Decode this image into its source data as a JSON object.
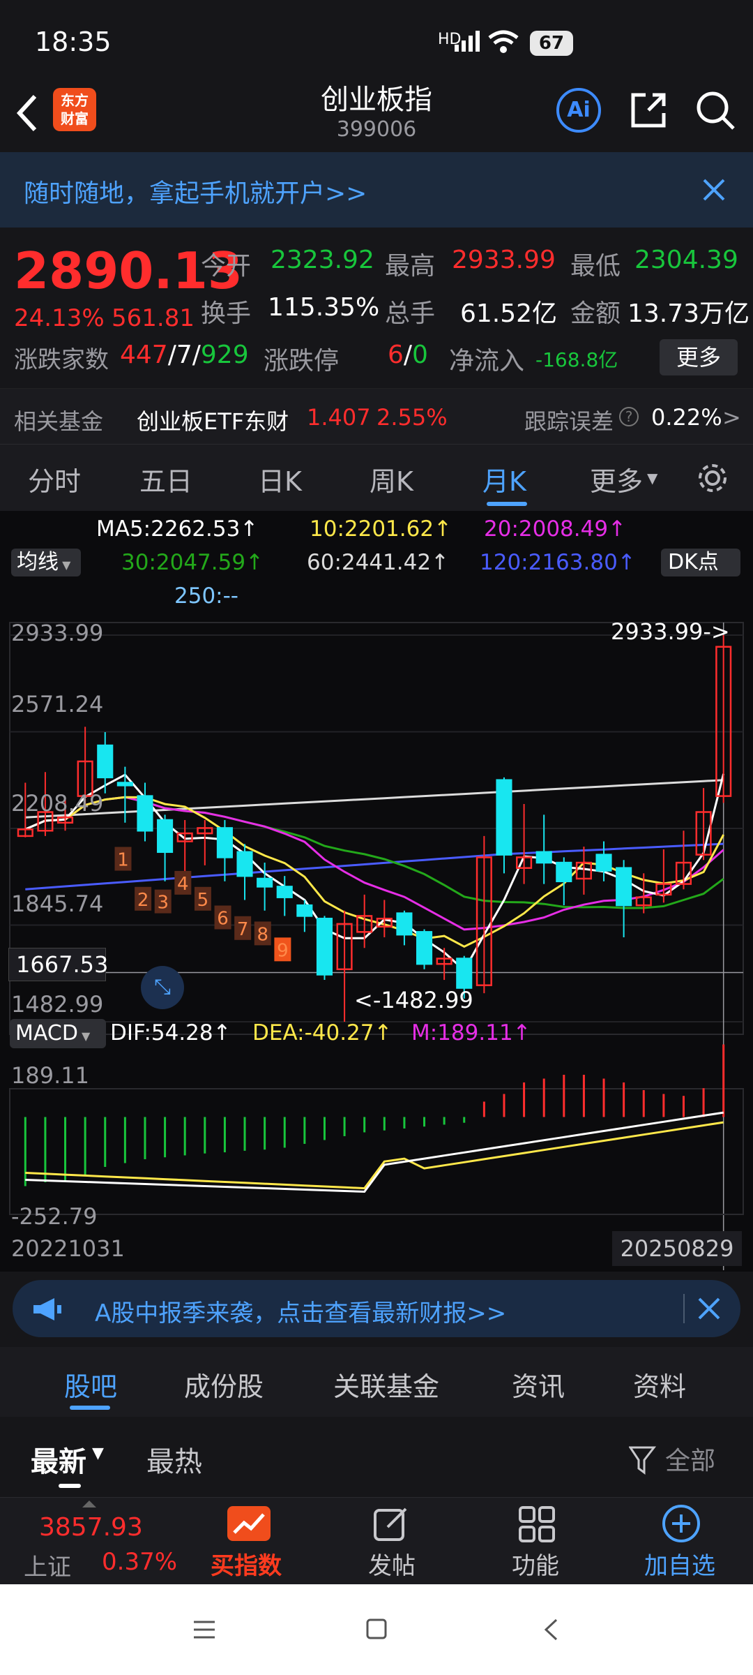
{
  "status": {
    "time": "18:35",
    "battery": "67",
    "signal": "HD"
  },
  "header": {
    "title": "创业板指",
    "code": "399006",
    "logo_line1": "东方",
    "logo_line2": "财富",
    "ai_label": "Ai"
  },
  "banner": {
    "text": "随时随地，拿起手机就开户>>"
  },
  "quote": {
    "price": "2890.13",
    "pct": "24.13%",
    "change": "561.81",
    "open_label": "今开",
    "open": "2323.92",
    "high_label": "最高",
    "high": "2933.99",
    "low_label": "最低",
    "low": "2304.39",
    "turnover_label": "换手",
    "turnover": "115.35%",
    "volume_label": "总手",
    "volume": "61.52亿",
    "amount_label": "金额",
    "amount": "13.73万亿",
    "updown_label": "涨跌家数",
    "up": "447",
    "flat": "7",
    "down": "929",
    "limit_label": "涨跌停",
    "limit_up": "6",
    "limit_down": "0",
    "inflow_label": "净流入",
    "inflow": "-168.8亿",
    "more": "更多"
  },
  "fund": {
    "label": "相关基金",
    "name": "创业板ETF东财",
    "price": "1.407",
    "pct": "2.55%",
    "track_label": "跟踪误差",
    "track_value": "0.22%",
    "arrow": ">"
  },
  "tabs": {
    "items": [
      "分时",
      "五日",
      "日K",
      "周K",
      "月K",
      "更多"
    ],
    "active": "月K"
  },
  "ma": {
    "ma5": "MA5:2262.53↑",
    "ma10": "10:2201.62↑",
    "ma20": "20:2008.49↑",
    "ma30": "30:2047.59↑",
    "ma60": "60:2441.42↑",
    "ma120": "120:2163.80↑",
    "ma250": "250:--",
    "selector": "均线",
    "dk": "DK点"
  },
  "axis": {
    "y1": "2933.99",
    "y2": "2571.24",
    "y3": "2208.49",
    "y4": "1845.74",
    "y5": "1482.99",
    "crosshair": "1667.53",
    "high_note": "2933.99->",
    "low_note": "<-1482.99"
  },
  "macd": {
    "label": "MACD",
    "dif": "DIF:54.28↑",
    "dea": "DEA:-40.27↑",
    "m": "M:189.11↑",
    "ytop": "189.11",
    "ybot": "-252.79",
    "date_start": "20221031",
    "date_end": "20250829"
  },
  "colors": {
    "up": "#ff2d2d",
    "down": "#18c63c",
    "cyan": "#18e6f0",
    "ma5": "#ffffff",
    "ma10": "#ffe84a",
    "ma20": "#e62ee6",
    "ma30": "#23a81a",
    "ma60": "#dcdcdc",
    "ma120": "#4a5cff",
    "accent": "#4ea3ff"
  },
  "nine_labels": [
    "1",
    "2",
    "3",
    "4",
    "5",
    "6",
    "7",
    "8",
    "9"
  ],
  "ad": {
    "text": "A股中报季来袭，点击查看最新财报>>"
  },
  "bottom_tabs": {
    "items": [
      "股吧",
      "成份股",
      "关联基金",
      "资讯",
      "资料"
    ],
    "active": "股吧"
  },
  "sort": {
    "latest": "最新",
    "hot": "最热",
    "filter": "全部"
  },
  "nav": {
    "index_price": "3857.93",
    "index_name": "上证",
    "index_pct": "0.37%",
    "buy": "买指数",
    "post": "发帖",
    "func": "功能",
    "add": "加自选"
  },
  "chart_data": {
    "type": "candlestick",
    "period": "month",
    "x_start": "20221031",
    "x_end": "20250829",
    "ylim": [
      1482.99,
      2933.99
    ],
    "candles": [
      {
        "o": 2180,
        "c": 2205,
        "h": 2380,
        "l": 2175
      },
      {
        "o": 2200,
        "c": 2270,
        "h": 2420,
        "l": 2180
      },
      {
        "o": 2230,
        "c": 2250,
        "h": 2320,
        "l": 2200
      },
      {
        "o": 2330,
        "c": 2460,
        "h": 2590,
        "l": 2280
      },
      {
        "o": 2520,
        "c": 2400,
        "h": 2570,
        "l": 2340
      },
      {
        "o": 2380,
        "c": 2370,
        "h": 2440,
        "l": 2230
      },
      {
        "o": 2330,
        "c": 2200,
        "h": 2380,
        "l": 2160
      },
      {
        "o": 2240,
        "c": 2120,
        "h": 2260,
        "l": 2010
      },
      {
        "o": 2160,
        "c": 2190,
        "h": 2240,
        "l": 2000
      },
      {
        "o": 2190,
        "c": 2210,
        "h": 2240,
        "l": 2070
      },
      {
        "o": 2210,
        "c": 2100,
        "h": 2240,
        "l": 2010
      },
      {
        "o": 2120,
        "c": 2030,
        "h": 2150,
        "l": 1940
      },
      {
        "o": 2020,
        "c": 1990,
        "h": 2080,
        "l": 1900
      },
      {
        "o": 1990,
        "c": 1950,
        "h": 2030,
        "l": 1880
      },
      {
        "o": 1920,
        "c": 1880,
        "h": 1940,
        "l": 1820
      },
      {
        "o": 1870,
        "c": 1660,
        "h": 1880,
        "l": 1640
      },
      {
        "o": 1680,
        "c": 1850,
        "h": 1900,
        "l": 1482.99
      },
      {
        "o": 1820,
        "c": 1880,
        "h": 1960,
        "l": 1760
      },
      {
        "o": 1840,
        "c": 1870,
        "h": 1940,
        "l": 1800
      },
      {
        "o": 1890,
        "c": 1810,
        "h": 1900,
        "l": 1770
      },
      {
        "o": 1820,
        "c": 1700,
        "h": 1830,
        "l": 1680
      },
      {
        "o": 1700,
        "c": 1720,
        "h": 1760,
        "l": 1640
      },
      {
        "o": 1720,
        "c": 1610,
        "h": 1730,
        "l": 1570
      },
      {
        "o": 1620,
        "c": 2100,
        "h": 2180,
        "l": 1590
      },
      {
        "o": 2390,
        "c": 2110,
        "h": 2400,
        "l": 2040
      },
      {
        "o": 2060,
        "c": 2100,
        "h": 2300,
        "l": 2000
      },
      {
        "o": 2120,
        "c": 2080,
        "h": 2260,
        "l": 2000
      },
      {
        "o": 2080,
        "c": 2010,
        "h": 2100,
        "l": 1920
      },
      {
        "o": 2020,
        "c": 2080,
        "h": 2140,
        "l": 1960
      },
      {
        "o": 2110,
        "c": 2050,
        "h": 2160,
        "l": 2010
      },
      {
        "o": 2060,
        "c": 1920,
        "h": 2090,
        "l": 1800
      },
      {
        "o": 1920,
        "c": 1950,
        "h": 2040,
        "l": 1890
      },
      {
        "o": 1960,
        "c": 2000,
        "h": 2130,
        "l": 1930
      },
      {
        "o": 2000,
        "c": 2080,
        "h": 2200,
        "l": 1980
      },
      {
        "o": 2110,
        "c": 2270,
        "h": 2360,
        "l": 2090
      },
      {
        "o": 2330,
        "c": 2890.13,
        "h": 2933.99,
        "l": 2304.39
      }
    ],
    "macd_hist": [
      -180,
      -170,
      -165,
      -150,
      -130,
      -120,
      -110,
      -105,
      -100,
      -95,
      -92,
      -88,
      -85,
      -80,
      -70,
      -60,
      -50,
      -40,
      -35,
      -30,
      -25,
      -20,
      -15,
      40,
      60,
      90,
      100,
      110,
      110,
      100,
      90,
      70,
      60,
      55,
      75,
      189.11
    ],
    "macd_ylim": [
      -252.79,
      189.11
    ]
  }
}
